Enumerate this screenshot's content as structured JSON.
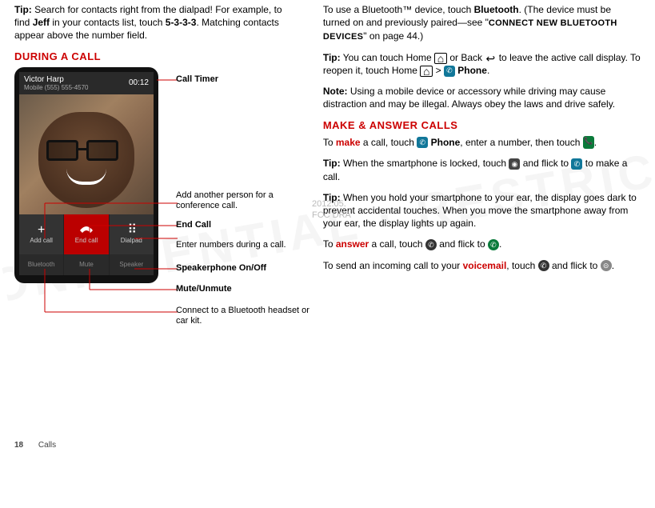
{
  "left": {
    "tip_intro": "Tip:",
    "tip_body_1": " Search for contacts right from the dialpad! For example, to find ",
    "tip_name": "Jeff",
    "tip_body_2": " in your contacts list, touch ",
    "tip_keys": "5-3-3-3",
    "tip_body_3": ". Matching contacts appear above the number field.",
    "heading": "DURING A CALL",
    "caller_name": "Victor Harp",
    "caller_number": "Mobile (555) 555-4570",
    "timer": "00:12",
    "btn_add": "Add call",
    "btn_end": "End call",
    "btn_dial": "Dialpad",
    "btn_bt": "Bluetooth",
    "btn_mute": "Mute",
    "btn_spk": "Speaker",
    "plus": "+",
    "grid": "⋮⋮⋮",
    "hang": "⏢",
    "callout_timer": "Call Timer",
    "callout_add": "Add another person for a conference call.",
    "callout_end": "End Call",
    "callout_dial": "Enter numbers during a call.",
    "callout_spk": "Speakerphone On/Off",
    "callout_mute": "Mute/Unmute",
    "callout_bt": "Connect to a Bluetooth headset or car kit."
  },
  "right": {
    "p1_a": "To use a Bluetooth™ device, touch ",
    "p1_bt": "Bluetooth",
    "p1_b": ". (The device must be turned on and previously paired—see \"",
    "p1_link": "CONNECT NEW BLUETOOTH DEVICES",
    "p1_c": "\" on page 44.)",
    "p2_tip": "Tip:",
    "p2_a": " You can touch Home ",
    "p2_b": " or Back ",
    "p2_c": " to leave the active call display. To reopen it, touch Home ",
    "p2_d": " > ",
    "p2_phone": "Phone",
    "p2_e": ".",
    "p3_note": "Note:",
    "p3_a": " Using a mobile device or accessory while driving may cause distraction and may be illegal. Always obey the laws and drive safely.",
    "heading2": "MAKE & ANSWER CALLS",
    "p4_a": "To ",
    "p4_make": "make",
    "p4_b": " a call, touch ",
    "p4_phone": "Phone",
    "p4_c": ", enter a number, then touch ",
    "p4_d": ".",
    "p5_tip": "Tip:",
    "p5_a": " When the smartphone is locked, touch ",
    "p5_b": " and flick to ",
    "p5_c": " to make a call.",
    "p6_tip": "Tip:",
    "p6_a": " When you hold your smartphone to your ear, the display goes dark to prevent accidental touches. When you move the smartphone away from your ear, the display lights up again.",
    "p7_a": "To ",
    "p7_ans": "answer",
    "p7_b": " a call, touch ",
    "p7_c": " and flick to ",
    "p7_d": ".",
    "p8_a": "To send an incoming call to your ",
    "p8_vm": "voicemail",
    "p8_b": ", touch ",
    "p8_c": " and flick to ",
    "p8_d": "."
  },
  "footer": {
    "page": "18",
    "section": "Calls"
  },
  "draft": {
    "l1": "2012.05.",
    "l2": "FCC DRA"
  }
}
